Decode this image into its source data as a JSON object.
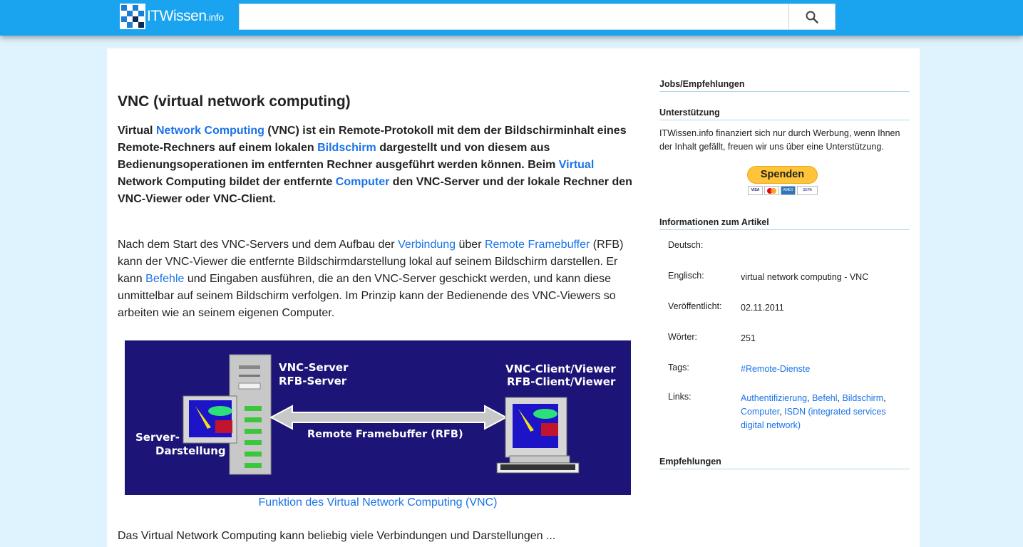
{
  "header": {
    "logo_text": "ITWissen",
    "logo_suffix": ".info",
    "search_placeholder": "",
    "search_icon": "search-icon"
  },
  "article": {
    "title": "VNC (virtual network computing)",
    "lead": {
      "t1": "Virtual ",
      "l1": "Network Computing",
      "t2": " (VNC) ist ein Remote-Protokoll mit dem der Bildschirminhalt eines Remote-Rechners auf einem lokalen ",
      "l2": "Bildschirm",
      "t3": " dargestellt und von diesem aus Bedienungsoperationen im entfernten Rechner ausgeführt werden können. Beim ",
      "l3": "Virtual",
      "t4": " Network Computing bildet der entfernte ",
      "l4": "Computer",
      "t5": " den VNC-Server und der lokale Rechner den VNC-Viewer oder VNC-Client."
    },
    "body": {
      "t1": "Nach dem Start des VNC-Servers und dem Aufbau der ",
      "l1": "Verbindung",
      "t2": " über ",
      "l2": "Remote Framebuffer",
      "t3": " (RFB) kann der VNC-Viewer die entfernte Bildschirmdarstellung lokal auf seinem Bildschirm darstellen. Er kann ",
      "l3": "Befehle",
      "t4": " und Eingaben ausführen, die an den VNC-Server geschickt werden, und kann diese unmittelbar auf seinem Bildschirm verfolgen. Im Prinzip kann der Bedienende des VNC-Viewers so arbeiten wie an seinem eigenen Computer."
    },
    "figure": {
      "server_label_1": "VNC-Server",
      "server_label_2": "RFB-Server",
      "client_label_1": "VNC-Client/Viewer",
      "client_label_2": "RFB-Client/Viewer",
      "display_label_1": "Server-",
      "display_label_2": "Darstellung",
      "arrow_label": "Remote Framebuffer (RFB)"
    },
    "caption": "Funktion des Virtual Network Computing (VNC)",
    "cutoff_text": "Das Virtual Network Computing kann beliebig viele Verbindungen und Darstellungen ..."
  },
  "sidebar": {
    "jobs_heading": "Jobs/Empfehlungen",
    "support_heading": "Unterstützung",
    "support_text": "ITWissen.info finanziert sich nur durch Werbung, wenn Ihnen der Inhalt gefällt, freuen wir uns über eine Unterstützung.",
    "donate_label": "Spenden",
    "card_labels": [
      "VISA",
      "",
      "AMEX",
      "SEPA"
    ],
    "info_heading": "Informationen zum Artikel",
    "info": {
      "deutsch_key": "Deutsch:",
      "deutsch_val": "",
      "englisch_key": "Englisch:",
      "englisch_val": "virtual network computing - VNC",
      "published_key": "Veröffentlicht:",
      "published_val": "02.11.2011",
      "words_key": "Wörter:",
      "words_val": "251",
      "tags_key": "Tags:",
      "tags_val": "#Remote-Dienste",
      "links_key": "Links:",
      "links": [
        "Authentifizierung",
        "Befehl",
        "Bildschirm",
        "Computer",
        "ISDN (integrated services digital network)"
      ]
    },
    "recommend_heading": "Empfehlungen"
  },
  "colors": {
    "header_bg": "#1aa3ee",
    "page_bg": "#dff3ff",
    "link": "#1a73e8",
    "figure_bg": "#1c1476"
  }
}
